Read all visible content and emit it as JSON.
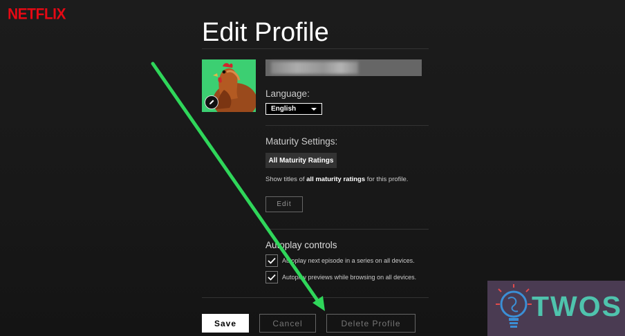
{
  "header": {
    "logo": "NETFLIX"
  },
  "page": {
    "title": "Edit Profile"
  },
  "profile": {
    "name_value": ""
  },
  "language": {
    "label": "Language:",
    "selected": "English"
  },
  "maturity": {
    "label": "Maturity Settings:",
    "badge": "All Maturity Ratings",
    "desc_prefix": "Show titles of ",
    "desc_bold": "all maturity ratings",
    "desc_suffix": " for this profile.",
    "edit_label": "Edit"
  },
  "autoplay": {
    "label": "Autoplay controls",
    "options": [
      {
        "label": "Autoplay next episode in a series on all devices.",
        "checked": true
      },
      {
        "label": "Autoplay previews while browsing on all devices.",
        "checked": true
      }
    ]
  },
  "actions": {
    "save": "Save",
    "cancel": "Cancel",
    "delete": "Delete Profile"
  },
  "watermark": {
    "text": "TWOS"
  },
  "colors": {
    "brand": "#e50914",
    "arrow": "#2fd65a",
    "watermark_text": "#4fc3ad"
  }
}
